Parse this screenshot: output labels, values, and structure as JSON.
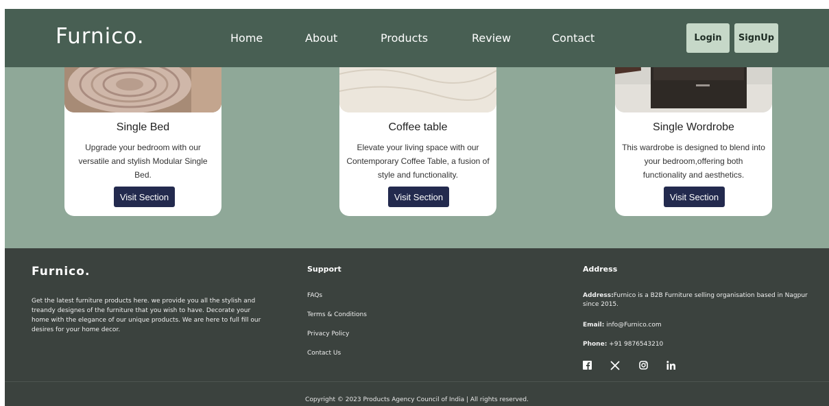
{
  "header": {
    "brand": "Furnico.",
    "nav": [
      "Home",
      "About",
      "Products",
      "Review",
      "Contact"
    ],
    "login_label": "Login",
    "signup_label": "SignUp"
  },
  "cards": [
    {
      "title": "Single Bed",
      "description": "Upgrade your bedroom with our versatile and stylish Modular Single Bed.",
      "button": "Visit Section"
    },
    {
      "title": "Coffee table",
      "description": "Elevate your living space with our Contemporary Coffee Table, a fusion of style and functionality.",
      "button": "Visit Section"
    },
    {
      "title": "Single Wordrobe",
      "description": "This wardrobe is designed to blend into your bedroom,offering both functionality and aesthetics.",
      "button": "Visit Section"
    }
  ],
  "footer": {
    "brand": "Furnico.",
    "about": "Get the latest furniture products here. we provide you all the stylish and treandy designes of the furniture that you wish to have. Decorate your home with the elegance of our unique products. We are here to full fill our desires for your home decor.",
    "support_heading": "Support",
    "support_links": [
      "FAQs",
      "Terms & Conditions",
      "Privacy Policy",
      "Contact Us"
    ],
    "address_heading": "Address",
    "address_label": "Address:",
    "address_text": "Furnico is a B2B Furniture selling organisation based in Nagpur since 2015.",
    "email_label": "Email:",
    "email_value": " info@Furnico.com",
    "phone_label": "Phone:",
    "phone_value": " +91 9876543210",
    "social_icons": [
      "facebook-icon",
      "x-icon",
      "instagram-icon",
      "linkedin-icon"
    ],
    "copyright": "Copyright © 2023 Products Agency Council of India | All rights reserved."
  },
  "colors": {
    "header_bg": "#485f53",
    "page_bg": "#8fa898",
    "footer_bg": "#3b423e",
    "button_bg": "#232a4e",
    "auth_button_bg": "#c6d8c8"
  }
}
